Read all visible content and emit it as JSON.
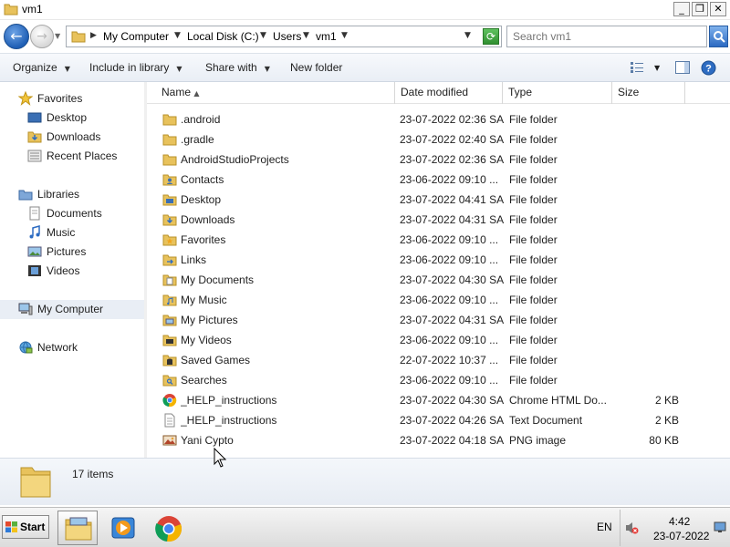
{
  "window": {
    "title": "vm1",
    "min_label": "_",
    "max_label": "❐",
    "close_label": "✕"
  },
  "address": {
    "back_glyph": "←",
    "forward_glyph": "→",
    "crumbs": [
      "My Computer",
      "Local Disk (C:)",
      "Users",
      "vm1"
    ],
    "search_placeholder": "Search vm1"
  },
  "toolbar": {
    "organize": "Organize",
    "include_in_library": "Include in library",
    "share_with": "Share with",
    "new_folder": "New folder"
  },
  "nav": {
    "favorites": "Favorites",
    "desktop": "Desktop",
    "downloads": "Downloads",
    "recent_places": "Recent Places",
    "libraries": "Libraries",
    "documents": "Documents",
    "music": "Music",
    "pictures": "Pictures",
    "videos": "Videos",
    "my_computer": "My Computer",
    "network": "Network"
  },
  "columns": {
    "name": "Name",
    "date": "Date modified",
    "type": "Type",
    "size": "Size"
  },
  "files": [
    {
      "name": ".android",
      "date": "23-07-2022 02:36 SA",
      "type": "File folder",
      "size": "",
      "icon": "folder-icon"
    },
    {
      "name": ".gradle",
      "date": "23-07-2022 02:40 SA",
      "type": "File folder",
      "size": "",
      "icon": "folder-icon"
    },
    {
      "name": "AndroidStudioProjects",
      "date": "23-07-2022 02:36 SA",
      "type": "File folder",
      "size": "",
      "icon": "folder-icon"
    },
    {
      "name": "Contacts",
      "date": "23-06-2022 09:10 ...",
      "type": "File folder",
      "size": "",
      "icon": "contacts-folder-icon"
    },
    {
      "name": "Desktop",
      "date": "23-07-2022 04:41 SA",
      "type": "File folder",
      "size": "",
      "icon": "desktop-folder-icon"
    },
    {
      "name": "Downloads",
      "date": "23-07-2022 04:31 SA",
      "type": "File folder",
      "size": "",
      "icon": "downloads-folder-icon"
    },
    {
      "name": "Favorites",
      "date": "23-06-2022 09:10 ...",
      "type": "File folder",
      "size": "",
      "icon": "favorites-folder-icon"
    },
    {
      "name": "Links",
      "date": "23-06-2022 09:10 ...",
      "type": "File folder",
      "size": "",
      "icon": "links-folder-icon"
    },
    {
      "name": "My Documents",
      "date": "23-07-2022 04:30 SA",
      "type": "File folder",
      "size": "",
      "icon": "documents-folder-icon"
    },
    {
      "name": "My Music",
      "date": "23-06-2022 09:10 ...",
      "type": "File folder",
      "size": "",
      "icon": "music-folder-icon"
    },
    {
      "name": "My Pictures",
      "date": "23-07-2022 04:31 SA",
      "type": "File folder",
      "size": "",
      "icon": "pictures-folder-icon"
    },
    {
      "name": "My Videos",
      "date": "23-06-2022 09:10 ...",
      "type": "File folder",
      "size": "",
      "icon": "videos-folder-icon"
    },
    {
      "name": "Saved Games",
      "date": "22-07-2022 10:37 ...",
      "type": "File folder",
      "size": "",
      "icon": "saved-games-folder-icon"
    },
    {
      "name": "Searches",
      "date": "23-06-2022 09:10 ...",
      "type": "File folder",
      "size": "",
      "icon": "searches-folder-icon"
    },
    {
      "name": "_HELP_instructions",
      "date": "23-07-2022 04:30 SA",
      "type": "Chrome HTML Do...",
      "size": "2 KB",
      "icon": "chrome-html-icon"
    },
    {
      "name": "_HELP_instructions",
      "date": "23-07-2022 04:26 SA",
      "type": "Text Document",
      "size": "2 KB",
      "icon": "text-document-icon"
    },
    {
      "name": "Yani Cypto",
      "date": "23-07-2022 04:18 SA",
      "type": "PNG image",
      "size": "80 KB",
      "icon": "png-image-icon"
    }
  ],
  "details": {
    "item_count": "17 items"
  },
  "taskbar": {
    "start": "Start",
    "language": "EN",
    "time": "4:42",
    "date": "23-07-2022"
  },
  "colors": {
    "folder": "#e8c25c",
    "selection": "#e9eef5",
    "accent_blue": "#1f5fb5"
  }
}
